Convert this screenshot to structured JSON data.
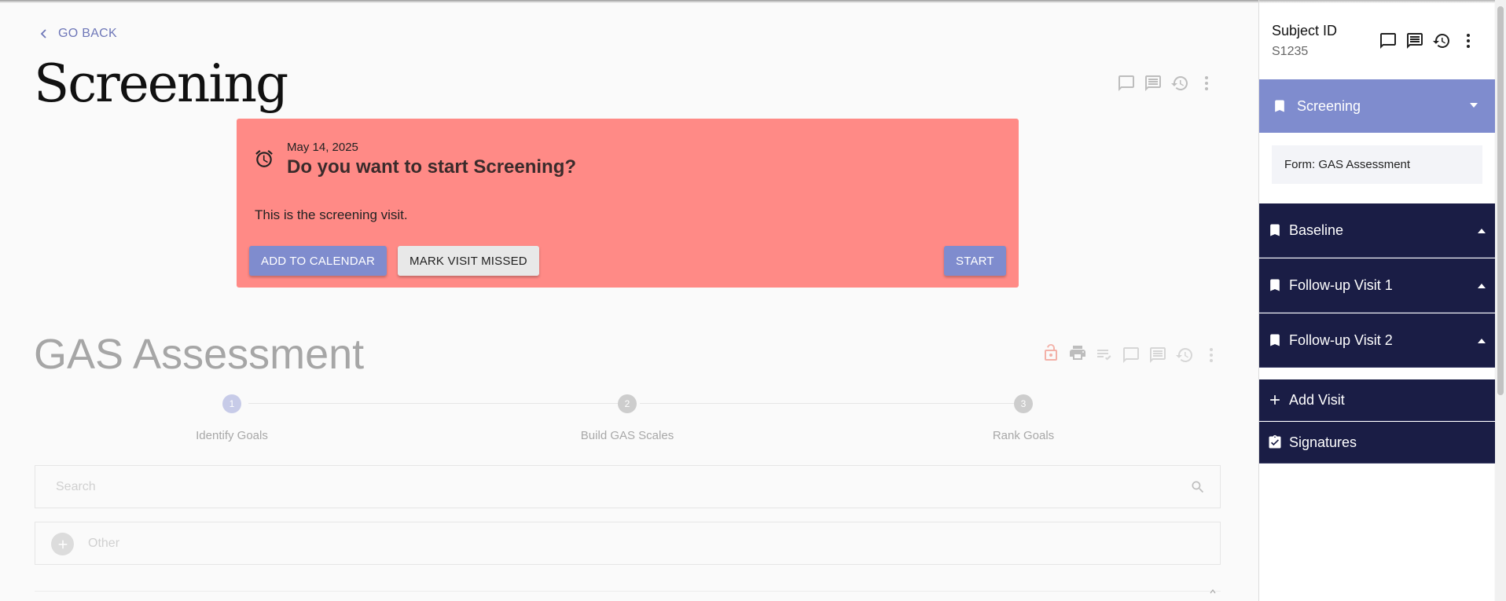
{
  "nav": {
    "go_back": "GO BACK"
  },
  "page": {
    "title": "Screening"
  },
  "banner": {
    "date": "May 14, 2025",
    "question": "Do you want to start Screening?",
    "description": "This is the screening visit.",
    "add_to_calendar": "ADD TO CALENDAR",
    "mark_missed": "MARK VISIT MISSED",
    "start": "START",
    "color": "#ff8a86"
  },
  "form": {
    "title": "GAS Assessment",
    "steps": [
      {
        "number": "1",
        "label": "Identify Goals"
      },
      {
        "number": "2",
        "label": "Build GAS Scales"
      },
      {
        "number": "3",
        "label": "Rank Goals"
      }
    ],
    "search_placeholder": "Search",
    "other_label": "Other"
  },
  "sidebar": {
    "subject_label": "Subject ID",
    "subject_id": "S1235",
    "active_visit": "Screening",
    "active_form": "Form: GAS Assessment",
    "visits": [
      "Baseline",
      "Follow-up Visit 1",
      "Follow-up Visit 2"
    ],
    "add_visit": "Add Visit",
    "signatures": "Signatures",
    "accent": "#7f8cce",
    "dark": "#1a1d45"
  }
}
